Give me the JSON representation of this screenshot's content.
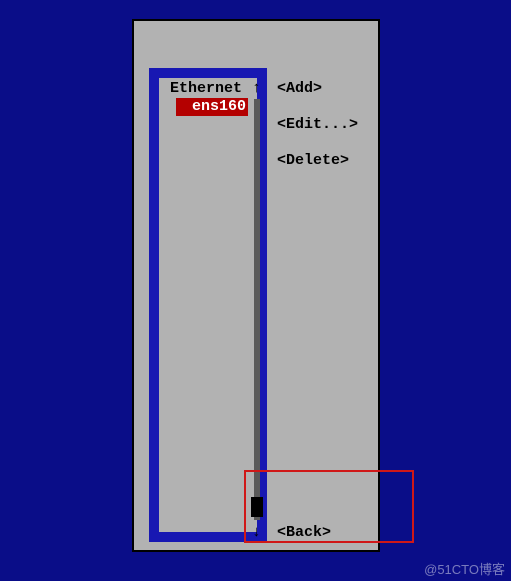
{
  "colors": {
    "background": "#0a0d88",
    "dialog_bg": "#b2b2b2",
    "inner_border": "#1818b2",
    "selection_bg": "#b40000",
    "selection_fg": "#ffffff",
    "highlight_box": "#d01818"
  },
  "list": {
    "header": "Ethernet",
    "items": [
      "ens160"
    ],
    "selected_index": 0,
    "arrow_up": "↑",
    "arrow_down": "↓"
  },
  "buttons": {
    "add": "<Add>",
    "edit": "<Edit...>",
    "delete": "<Delete>",
    "back": "<Back>"
  },
  "watermark": "@51CTO博客"
}
